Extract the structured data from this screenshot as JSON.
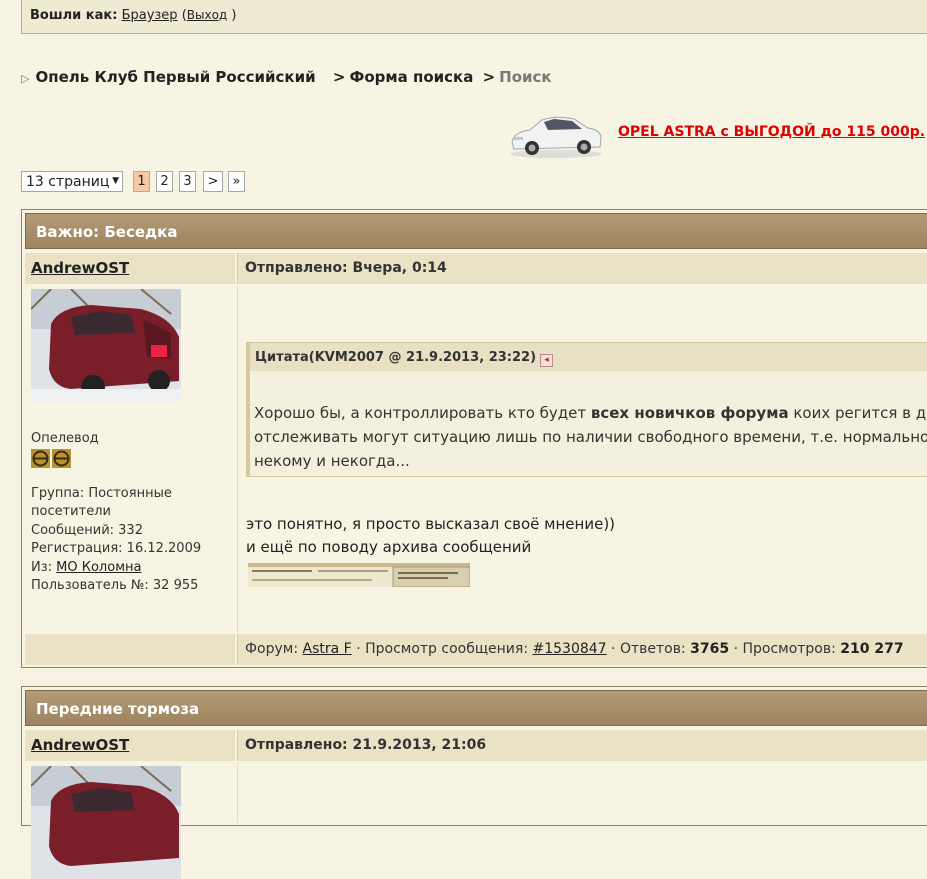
{
  "userbar": {
    "logged_in_label": "Вошли как:",
    "username": "Браузер",
    "open_paren": "(",
    "logout": "Выход",
    "close_paren": ")"
  },
  "breadcrumb": {
    "items": [
      "Опель Клуб Первый Российский",
      "Форма поиска",
      "Поиск"
    ],
    "separator": ">"
  },
  "ad": {
    "text": "OPEL ASTRA с ВЫГОДОЙ до 115 000р."
  },
  "pagination": {
    "pages_label": "13 страниц",
    "pages": [
      "1",
      "2",
      "3"
    ],
    "active": "1",
    "next": ">",
    "last": "»"
  },
  "posts": [
    {
      "title": "Важно: Беседка",
      "author": "AndrewOST",
      "posted": "Отправлено: Вчера, 0:14",
      "rank": "Опелевод",
      "group": "Группа: Постоянные",
      "group_cont": "посетители",
      "messages": "Сообщений: 332",
      "registered": "Регистрация: 16.12.2009",
      "from_label": "Из:",
      "from_value": "МО Коломна",
      "user_no": "Пользователь №: 32 955",
      "quote_head": "Цитата(KVM2007 @ 21.9.2013, 23:22)",
      "quote_line1_a": "Хорошо бы, а контроллировать кто будет ",
      "quote_line1_b": "всех новичков форума",
      "quote_line1_c": " коих регится в де",
      "quote_line2": "отслеживать могут ситуацию лишь по наличии свободного времени, т.е. нормального",
      "quote_line3": "некому и некогда...",
      "text_line1": "это понятно, я просто высказал своё мнение))",
      "text_line2": "и ещё по поводу архива сообщений",
      "foot_forum_label": "Форум:",
      "foot_forum": "Astra F",
      "foot_view_label": "· Просмотр сообщения:",
      "foot_view": "#1530847",
      "foot_replies_label": "· Ответов:",
      "foot_replies": "3765",
      "foot_views_label": "· Просмотров:",
      "foot_views": "210 277"
    },
    {
      "title": "Передние тормоза",
      "author": "AndrewOST",
      "posted": "Отправлено: 21.9.2013, 21:06"
    }
  ]
}
